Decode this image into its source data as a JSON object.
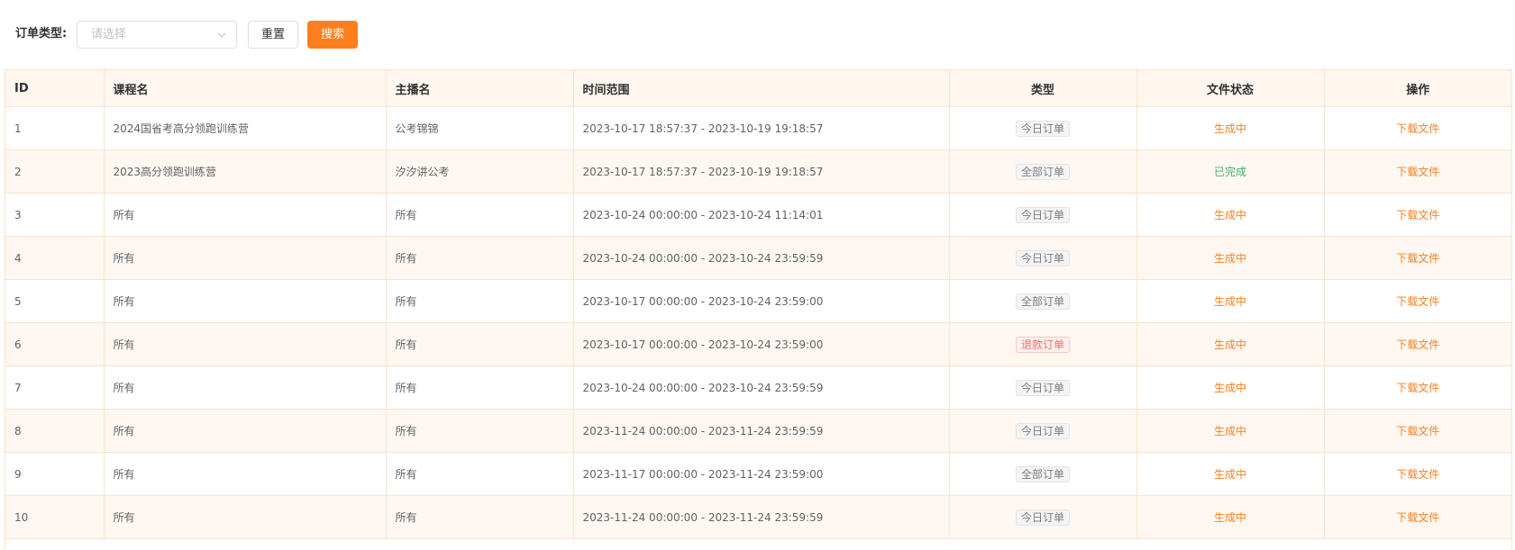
{
  "filter": {
    "label": "订单类型:",
    "select_placeholder": "请选择",
    "reset_label": "重置",
    "search_label": "搜索"
  },
  "table": {
    "headers": [
      "ID",
      "课程名",
      "主播名",
      "时间范围",
      "类型",
      "文件状态",
      "操作"
    ],
    "rows": [
      {
        "id": "1",
        "course": "2024国省考高分领跑训练营",
        "host": "公考锦锦",
        "range": "2023-10-17 18:57:37 - 2023-10-19 19:18:57",
        "type": "今日订单",
        "type_style": "normal",
        "status": "生成中",
        "status_style": "pending",
        "action": "下载文件"
      },
      {
        "id": "2",
        "course": "2023高分领跑训练营",
        "host": "汐汐讲公考",
        "range": "2023-10-17 18:57:37 - 2023-10-19 19:18:57",
        "type": "全部订单",
        "type_style": "normal",
        "status": "已完成",
        "status_style": "done",
        "action": "下载文件"
      },
      {
        "id": "3",
        "course": "所有",
        "host": "所有",
        "range": "2023-10-24 00:00:00 - 2023-10-24 11:14:01",
        "type": "今日订单",
        "type_style": "normal",
        "status": "生成中",
        "status_style": "pending",
        "action": "下载文件"
      },
      {
        "id": "4",
        "course": "所有",
        "host": "所有",
        "range": "2023-10-24 00:00:00 - 2023-10-24 23:59:59",
        "type": "今日订单",
        "type_style": "normal",
        "status": "生成中",
        "status_style": "pending",
        "action": "下载文件"
      },
      {
        "id": "5",
        "course": "所有",
        "host": "所有",
        "range": "2023-10-17 00:00:00 - 2023-10-24 23:59:00",
        "type": "全部订单",
        "type_style": "normal",
        "status": "生成中",
        "status_style": "pending",
        "action": "下载文件"
      },
      {
        "id": "6",
        "course": "所有",
        "host": "所有",
        "range": "2023-10-17 00:00:00 - 2023-10-24 23:59:00",
        "type": "退款订单",
        "type_style": "danger",
        "status": "生成中",
        "status_style": "pending",
        "action": "下载文件"
      },
      {
        "id": "7",
        "course": "所有",
        "host": "所有",
        "range": "2023-10-24 00:00:00 - 2023-10-24 23:59:59",
        "type": "今日订单",
        "type_style": "normal",
        "status": "生成中",
        "status_style": "pending",
        "action": "下载文件"
      },
      {
        "id": "8",
        "course": "所有",
        "host": "所有",
        "range": "2023-11-24 00:00:00 - 2023-11-24 23:59:59",
        "type": "今日订单",
        "type_style": "normal",
        "status": "生成中",
        "status_style": "pending",
        "action": "下载文件"
      },
      {
        "id": "9",
        "course": "所有",
        "host": "所有",
        "range": "2023-11-17 00:00:00 - 2023-11-24 23:59:00",
        "type": "全部订单",
        "type_style": "normal",
        "status": "生成中",
        "status_style": "pending",
        "action": "下载文件"
      },
      {
        "id": "10",
        "course": "所有",
        "host": "所有",
        "range": "2023-11-24 00:00:00 - 2023-11-24 23:59:59",
        "type": "今日订单",
        "type_style": "normal",
        "status": "生成中",
        "status_style": "pending",
        "action": "下载文件"
      }
    ]
  },
  "colors": {
    "accent": "#ff7f1e",
    "success": "#3cb371",
    "danger": "#f56c6c",
    "header_bg": "#fff7f0",
    "border": "#fbe3cc"
  },
  "icons": {
    "select_arrow": "chevron-down-icon"
  }
}
